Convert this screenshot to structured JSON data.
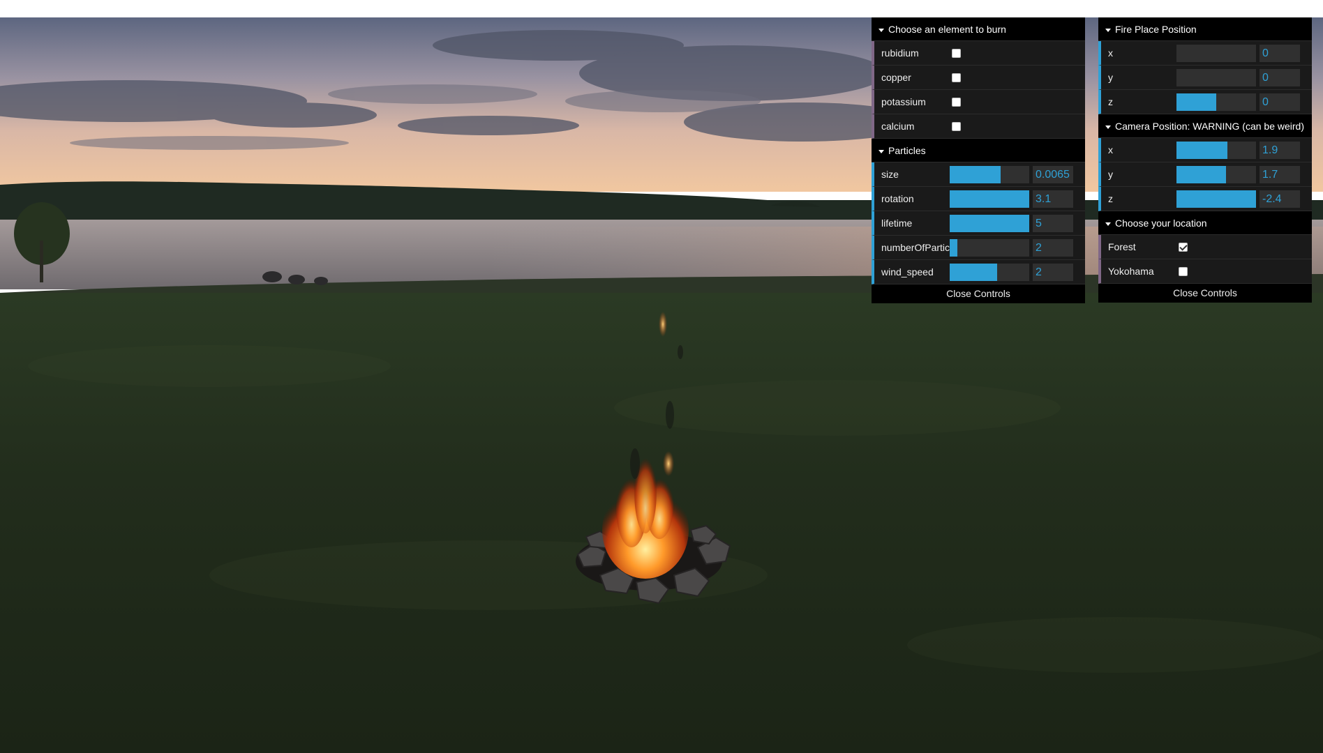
{
  "left_gui": {
    "elements_folder": {
      "title": "Choose an element to burn",
      "items": [
        {
          "label": "rubidium",
          "checked": false
        },
        {
          "label": "copper",
          "checked": false
        },
        {
          "label": "potassium",
          "checked": false
        },
        {
          "label": "calcium",
          "checked": false
        }
      ]
    },
    "particles_folder": {
      "title": "Particles",
      "items": [
        {
          "label": "size",
          "value": "0.0065",
          "fill": 0.64
        },
        {
          "label": "rotation",
          "value": "3.1",
          "fill": 1.0
        },
        {
          "label": "lifetime",
          "value": "5",
          "fill": 1.0
        },
        {
          "label": "numberOfParticles",
          "value": "2",
          "fill": 0.1
        },
        {
          "label": "wind_speed",
          "value": "2",
          "fill": 0.6
        }
      ]
    },
    "close_label": "Close Controls"
  },
  "right_gui": {
    "fire_folder": {
      "title": "Fire Place Position",
      "items": [
        {
          "label": "x",
          "value": "0",
          "fill": 0.0
        },
        {
          "label": "y",
          "value": "0",
          "fill": 0.0
        },
        {
          "label": "z",
          "value": "0",
          "fill": 0.5
        }
      ]
    },
    "camera_folder": {
      "title": "Camera Position: WARNING (can be weird)",
      "items": [
        {
          "label": "x",
          "value": "1.9",
          "fill": 0.64
        },
        {
          "label": "y",
          "value": "1.7",
          "fill": 0.62
        },
        {
          "label": "z",
          "value": "-2.4",
          "fill": 1.0
        }
      ]
    },
    "location_folder": {
      "title": "Choose your location",
      "items": [
        {
          "label": "Forest",
          "checked": true
        },
        {
          "label": "Yokohama",
          "checked": false
        }
      ]
    },
    "close_label": "Close Controls"
  },
  "colors": {
    "panel_bg": "#1a1a1a",
    "title_bg": "#000000",
    "number_accent": "#2fa1d6",
    "bool_accent": "#806787"
  }
}
